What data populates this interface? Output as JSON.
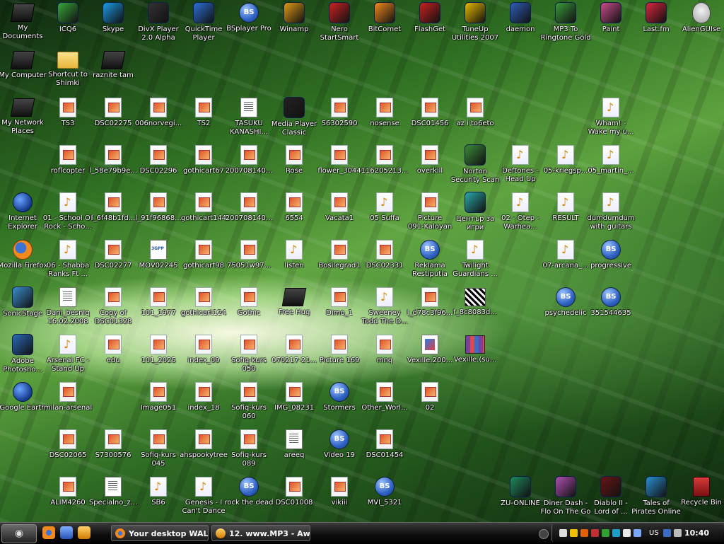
{
  "desktop": {
    "icons": [
      {
        "label": "My\nDocuments",
        "icon": "documents-icon"
      },
      {
        "label": "ICQ6",
        "icon": "icq-icon"
      },
      {
        "label": "Skype",
        "icon": "skype-icon"
      },
      {
        "label": "DivX Player\n2.0 Alpha",
        "icon": "divx-icon"
      },
      {
        "label": "QuickTime\nPlayer",
        "icon": "quicktime-icon"
      },
      {
        "label": "BSplayer Pro",
        "icon": "bsplayer-icon"
      },
      {
        "label": "Winamp",
        "icon": "winamp-icon"
      },
      {
        "label": "Nero\nStartSmart",
        "icon": "nero-icon"
      },
      {
        "label": "BitComet",
        "icon": "bitcomet-icon"
      },
      {
        "label": "FlashGet",
        "icon": "flashget-icon"
      },
      {
        "label": "TuneUp\nUtilities 2007",
        "icon": "tuneup-icon"
      },
      {
        "label": "daemon",
        "icon": "daemon-icon"
      },
      {
        "label": "MP3 To\nRingtone Gold",
        "icon": "ringtone-icon"
      },
      {
        "label": "Paint",
        "icon": "paint-icon"
      },
      {
        "label": "Last.fm",
        "icon": "lastfm-icon"
      },
      {
        "label": "AlienGUIse",
        "icon": "alien-icon"
      },
      {
        "label": "My Computer",
        "icon": "computer-icon"
      },
      {
        "label": "Shortcut to\nShimki",
        "icon": "folder-shortcut-icon"
      },
      {
        "label": "raznite tam",
        "icon": "shortcut-icon"
      },
      {
        "label": "My Network\nPlaces",
        "icon": "network-icon"
      },
      {
        "label": "TS3",
        "icon": "image-file-icon"
      },
      {
        "label": "DSC02275",
        "icon": "image-file-icon"
      },
      {
        "label": "006norvegi...",
        "icon": "image-file-icon"
      },
      {
        "label": "TS2",
        "icon": "image-file-icon"
      },
      {
        "label": "TASUKU\nKANASHI...",
        "icon": "document-icon"
      },
      {
        "label": "Media Player\nClassic",
        "icon": "media-player-icon"
      },
      {
        "label": "S6302590",
        "icon": "image-file-icon"
      },
      {
        "label": "nosense",
        "icon": "image-file-icon"
      },
      {
        "label": "DSC01456",
        "icon": "image-file-icon"
      },
      {
        "label": "az i to6eto",
        "icon": "image-file-icon"
      },
      {
        "label": "Wham! -\nWake my u...",
        "icon": "audio-file-icon"
      },
      {
        "label": "roflcopter",
        "icon": "image-file-icon"
      },
      {
        "label": "l_58e79b9e...",
        "icon": "image-file-icon"
      },
      {
        "label": "DSC02296",
        "icon": "image-file-icon"
      },
      {
        "label": "gothicart67",
        "icon": "image-file-icon"
      },
      {
        "label": "200708140...",
        "icon": "image-file-icon"
      },
      {
        "label": "Rose",
        "icon": "image-file-icon"
      },
      {
        "label": "flower_3044",
        "icon": "image-file-icon"
      },
      {
        "label": "116205213...",
        "icon": "image-file-icon"
      },
      {
        "label": "overkill",
        "icon": "image-file-icon"
      },
      {
        "label": "Norton\nSecurity Scan",
        "icon": "norton-icon"
      },
      {
        "label": "Deftones -\nHead Up",
        "icon": "audio-file-icon"
      },
      {
        "label": "05-kriegsp...",
        "icon": "audio-file-icon"
      },
      {
        "label": "05_martin_...",
        "icon": "audio-file-icon"
      },
      {
        "label": "Internet\nExplorer",
        "icon": "internet-explorer-icon"
      },
      {
        "label": "01 - School Of\nRock - Scho...",
        "icon": "audio-file-icon"
      },
      {
        "label": "l_6f48b1fd...",
        "icon": "image-file-icon"
      },
      {
        "label": "l_91f96868...",
        "icon": "image-file-icon"
      },
      {
        "label": "gothicart144",
        "icon": "image-file-icon"
      },
      {
        "label": "200708140...",
        "icon": "image-file-icon"
      },
      {
        "label": "6554",
        "icon": "image-file-icon"
      },
      {
        "label": "Vacata1",
        "icon": "image-file-icon"
      },
      {
        "label": "05 Suffa",
        "icon": "audio-file-icon"
      },
      {
        "label": "Picture\n091-Kaloyan",
        "icon": "image-file-icon"
      },
      {
        "label": "Център за\nигри",
        "icon": "game-center-icon"
      },
      {
        "label": "02 - Otep -\nWarhea...",
        "icon": "audio-file-icon"
      },
      {
        "label": "RESULT",
        "icon": "audio-file-icon"
      },
      {
        "label": "dumdumdum\nwith guitars",
        "icon": "audio-file-icon"
      },
      {
        "label": "Mozilla Firefox",
        "icon": "firefox-icon"
      },
      {
        "label": "06 - Shabba\nRanks Ft ...",
        "icon": "audio-file-icon"
      },
      {
        "label": "DSC02277",
        "icon": "image-file-icon"
      },
      {
        "label": "MOV02245",
        "icon": "video-file-icon"
      },
      {
        "label": "gothicart98",
        "icon": "image-file-icon"
      },
      {
        "label": "75051w97...",
        "icon": "image-file-icon"
      },
      {
        "label": "listen",
        "icon": "audio-file-icon"
      },
      {
        "label": "Bosilegrad1",
        "icon": "image-file-icon"
      },
      {
        "label": "DSC02331",
        "icon": "image-file-icon"
      },
      {
        "label": "Reklama\nRestiputia",
        "icon": "bsplayer-file-icon"
      },
      {
        "label": "Twilight\nGuardians ...",
        "icon": "audio-file-icon"
      },
      {
        "label": "07-arcana_...",
        "icon": "audio-file-icon"
      },
      {
        "label": "progressive",
        "icon": "bsplayer-file-icon"
      },
      {
        "label": "SonicStage",
        "icon": "sonicstage-icon"
      },
      {
        "label": "Dani_besniq\n16.02.2008",
        "icon": "document-icon"
      },
      {
        "label": "Copy of\nDSC01328",
        "icon": "image-file-icon"
      },
      {
        "label": "101_1977",
        "icon": "image-file-icon"
      },
      {
        "label": "gothicart124",
        "icon": "image-file-icon"
      },
      {
        "label": "Gothic",
        "icon": "image-file-icon"
      },
      {
        "label": "Free Hug",
        "icon": "shortcut-icon"
      },
      {
        "label": "Dimo_1",
        "icon": "image-file-icon"
      },
      {
        "label": "Sweeney\nTodd The D...",
        "icon": "audio-file-icon"
      },
      {
        "label": "l_d78c3f96...",
        "icon": "image-file-icon"
      },
      {
        "label": "f_8c8083d...",
        "icon": "bw-image-icon"
      },
      {
        "label": "psychedelic",
        "icon": "bsplayer-file-icon"
      },
      {
        "label": "351544635",
        "icon": "bsplayer-file-icon"
      },
      {
        "label": "Adobe\nPhotosho...",
        "icon": "photoshop-icon"
      },
      {
        "label": "Arsenal FC -\nStand Up",
        "icon": "audio-file-icon"
      },
      {
        "label": "edu",
        "icon": "image-file-icon"
      },
      {
        "label": "101_2025",
        "icon": "image-file-icon"
      },
      {
        "label": "index_09",
        "icon": "image-file-icon"
      },
      {
        "label": "Sofiq-kurs\n050",
        "icon": "image-file-icon"
      },
      {
        "label": "070217-21...",
        "icon": "image-file-icon"
      },
      {
        "label": "Picture 169",
        "icon": "image-file-icon"
      },
      {
        "label": "mnq",
        "icon": "image-file-icon"
      },
      {
        "label": "Vexille.200...",
        "icon": "notepad-file-icon"
      },
      {
        "label": "Vexille.(su...",
        "icon": "rar-archive-icon"
      },
      {
        "label": "Google Earth",
        "icon": "google-earth-icon"
      },
      {
        "label": "milan-arsenal",
        "icon": "image-file-icon"
      },
      {
        "label": "Image051",
        "icon": "image-file-icon"
      },
      {
        "label": "index_18",
        "icon": "image-file-icon"
      },
      {
        "label": "Sofiq-kurs\n060",
        "icon": "image-file-icon"
      },
      {
        "label": "IMG_08231",
        "icon": "image-file-icon"
      },
      {
        "label": "Stormers",
        "icon": "bsplayer-file-icon"
      },
      {
        "label": "Other_Worl...",
        "icon": "image-file-icon"
      },
      {
        "label": "02",
        "icon": "image-file-icon"
      },
      {
        "label": "DSC02065",
        "icon": "image-file-icon"
      },
      {
        "label": "S7300576",
        "icon": "image-file-icon"
      },
      {
        "label": "Sofiq-kurs\n045",
        "icon": "image-file-icon"
      },
      {
        "label": "ahspookytree",
        "icon": "image-file-icon"
      },
      {
        "label": "Sofiq-kurs\n089",
        "icon": "image-file-icon"
      },
      {
        "label": "areeq",
        "icon": "document-icon"
      },
      {
        "label": "Video 19",
        "icon": "bsplayer-file-icon"
      },
      {
        "label": "DSC01454",
        "icon": "image-file-icon"
      },
      {
        "label": "ALIM4260",
        "icon": "image-file-icon"
      },
      {
        "label": "Specialno_z...",
        "icon": "document-icon"
      },
      {
        "label": "SB6",
        "icon": "audio-file-icon"
      },
      {
        "label": "Genesis - I\nCan't Dance",
        "icon": "audio-file-icon"
      },
      {
        "label": "rock the dead",
        "icon": "bsplayer-file-icon"
      },
      {
        "label": "DSC01008",
        "icon": "image-file-icon"
      },
      {
        "label": "vikiii",
        "icon": "image-file-icon"
      },
      {
        "label": "MVI_5321",
        "icon": "bsplayer-file-icon"
      },
      {
        "label": "ZU-ONLINE",
        "icon": "zu-online-icon"
      },
      {
        "label": "Diner Dash -\nFlo On The Go",
        "icon": "diner-dash-icon"
      },
      {
        "label": "Diablo II -\nLord of ...",
        "icon": "diablo-icon"
      },
      {
        "label": "Tales of\nPirates Online",
        "icon": "pirates-icon"
      },
      {
        "label": "Recycle Bin",
        "icon": "recycle-bin-icon"
      }
    ]
  },
  "taskbar": {
    "start_icon": "alien-start-icon",
    "quick_launch": [
      "firefox-icon",
      "internet-explorer-icon",
      "winamp-icon"
    ],
    "tasks": [
      {
        "label": "Your desktop WAL...",
        "icon": "firefox-icon"
      },
      {
        "label": "12. www.MP3 - Aw...",
        "icon": "winamp-icon"
      }
    ],
    "tray": {
      "language": "US",
      "clock": "10:40"
    }
  }
}
